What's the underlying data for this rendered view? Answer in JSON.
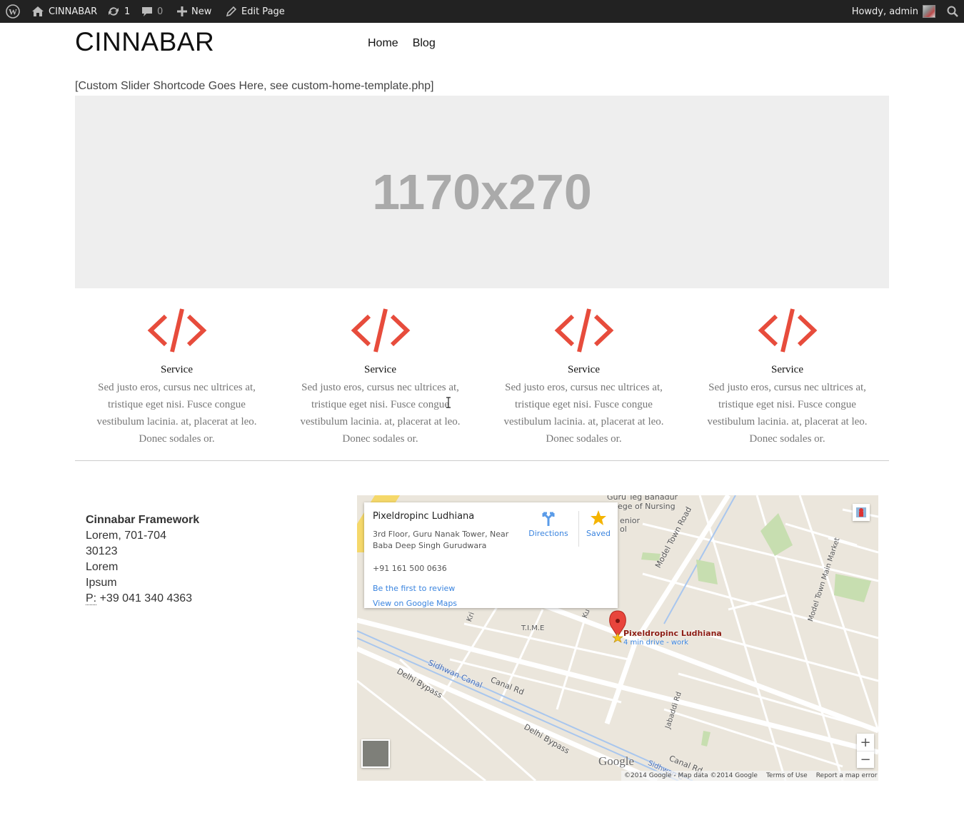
{
  "adminbar": {
    "site_name": "CINNABAR",
    "updates_count": "1",
    "comments_count": "0",
    "new_label": "New",
    "edit_label": "Edit Page",
    "howdy": "Howdy, admin"
  },
  "header": {
    "site_title": "CINNABAR",
    "nav": [
      "Home",
      "Blog"
    ]
  },
  "slider": {
    "note": "[Custom Slider Shortcode Goes Here, see custom-home-template.php]",
    "placeholder_text": "1170x270"
  },
  "services": [
    {
      "icon": "code-icon",
      "title": "Service",
      "text": "Sed justo eros, cursus nec ultrices at, tristique eget nisi. Fusce congue vestibulum lacinia. at, placerat at leo. Donec sodales or."
    },
    {
      "icon": "code-icon",
      "title": "Service",
      "text": "Sed justo eros, cursus nec ultrices at, tristique eget nisi. Fusce congue vestibulum lacinia. at, placerat at leo. Donec sodales or."
    },
    {
      "icon": "code-icon",
      "title": "Service",
      "text": "Sed justo eros, cursus nec ultrices at, tristique eget nisi. Fusce congue vestibulum lacinia. at, placerat at leo. Donec sodales or."
    },
    {
      "icon": "code-icon",
      "title": "Service",
      "text": "Sed justo eros, cursus nec ultrices at, tristique eget nisi. Fusce congue vestibulum lacinia. at, placerat at leo. Donec sodales or."
    }
  ],
  "contact": {
    "name": "Cinnabar Framework",
    "line1": "Lorem, 701-704",
    "line2": "30123",
    "line3": "Lorem",
    "line4": "Ipsum",
    "phone_abbr": "P:",
    "phone": "+39 041 340 4363"
  },
  "map": {
    "place_title": "Pixeldropinc Ludhiana",
    "address": "3rd Floor, Guru Nanak Tower, Near Baba Deep Singh Gurudwara",
    "phone": "+91 161 500 0636",
    "review_link": "Be the first to review",
    "maps_link": "View on Google Maps",
    "directions_label": "Directions",
    "saved_label": "Saved",
    "pin_label": "Pixeldropinc Ludhiana",
    "pin_sub": "4 min drive - work",
    "labels": {
      "guru": "Guru Teg Bahadur",
      "nursing": "ege of Nursing",
      "senior": "enior",
      "ol": "ol",
      "model_town_road": "Model Town Road",
      "model_town_main": "Model Town Main Market",
      "time": "T.I.M.E",
      "sidhwan_canal": "Sidhwan Canal",
      "canal_rd": "Canal Rd",
      "delhi_bypass_1": "Delhi Bypass",
      "delhi_bypass_2": "Delhi Bypass",
      "jabaddi": "Jabaddi Rd",
      "canal_rd_2": "Canal Rd",
      "sidhwan_2": "Sidhwan C",
      "kri": "Kri",
      "ku": "Ku"
    },
    "google_logo": "Google",
    "attribution": "©2014 Google - Map data ©2014 Google",
    "terms": "Terms of Use",
    "report": "Report a map error",
    "zoom_in": "+",
    "zoom_out": "−"
  },
  "colors": {
    "accent": "#e74c3c",
    "adminbar_bg": "#222222",
    "placeholder_bg": "#eeeeee",
    "placeholder_text": "#aaaaaa",
    "link_blue": "#3a84df"
  }
}
